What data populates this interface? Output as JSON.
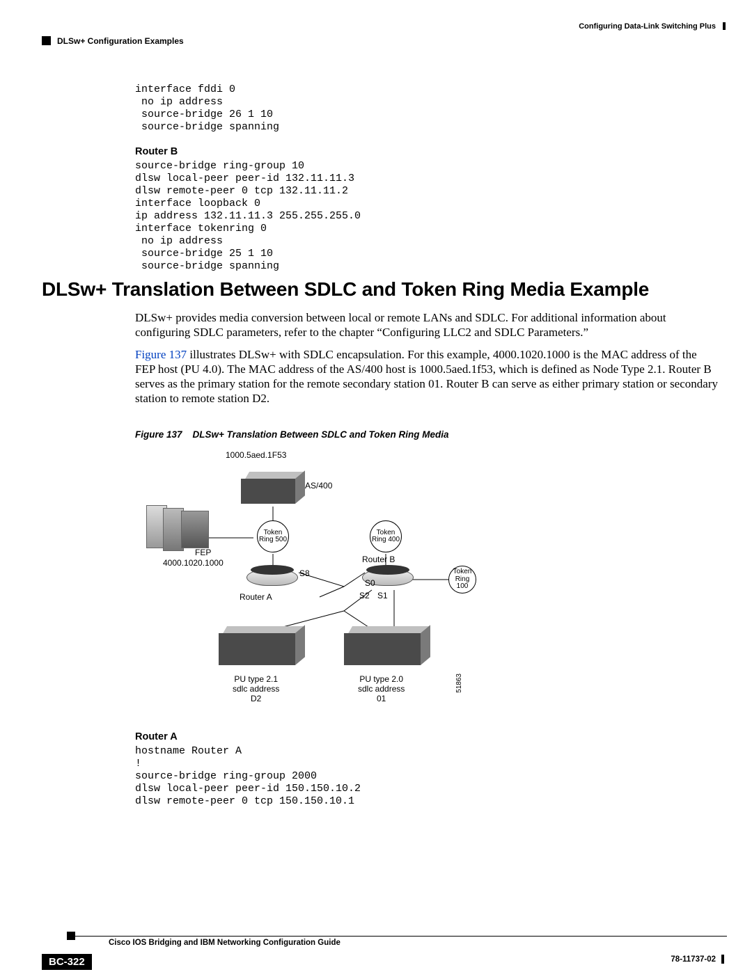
{
  "header": {
    "chapter": "Configuring Data-Link Switching Plus",
    "section": "DLSw+ Configuration Examples"
  },
  "code_block_1": "interface fddi 0\n no ip address\n source-bridge 26 1 10\n source-bridge spanning",
  "router_b_heading": "Router B",
  "code_block_2": "source-bridge ring-group 10\ndlsw local-peer peer-id 132.11.11.3\ndlsw remote-peer 0 tcp 132.11.11.2\ninterface loopback 0\nip address 132.11.11.3 255.255.255.0\ninterface tokenring 0\n no ip address\n source-bridge 25 1 10\n source-bridge spanning",
  "main_heading": "DLSw+ Translation Between SDLC and Token Ring Media Example",
  "para1": "DLSw+ provides media conversion between local or remote LANs and SDLC. For additional information about configuring SDLC parameters, refer to the chapter “Configuring LLC2 and SDLC Parameters.”",
  "para2_link": "Figure 137",
  "para2_rest": " illustrates DLSw+ with SDLC encapsulation. For this example, 4000.1020.1000 is the MAC address of the FEP host (PU 4.0). The MAC address of the AS/400 host is 1000.5aed.1f53, which is defined as Node Type 2.1. Router B serves as the primary station for the remote secondary station 01. Router B can serve as either primary station or secondary station to remote station D2.",
  "figure_caption_prefix": "Figure 137",
  "figure_caption_title": "DLSw+ Translation Between SDLC and Token Ring Media",
  "diagram": {
    "as400_mac": "1000.5aed.1F53",
    "as400_label": "AS/400",
    "fep_label": "FEP",
    "fep_mac": "4000.1020.1000",
    "tr500": "Token\nRing\n500",
    "tr400": "Token\nRing\n400",
    "tr100": "Token\nRing\n100",
    "router_a": "Router A",
    "router_b": "Router B",
    "s8": "S8",
    "s0": "S0",
    "s1": "S1",
    "s2": "S2",
    "pu21": "PU type 2.1\nsdlc address\nD2",
    "pu20": "PU type 2.0\nsdlc address\n01",
    "ref_id": "51863"
  },
  "router_a_heading": "Router A",
  "code_block_3": "hostname Router A\n!\nsource-bridge ring-group 2000\ndlsw local-peer peer-id 150.150.10.2\ndlsw remote-peer 0 tcp 150.150.10.1",
  "footer": {
    "guide": "Cisco IOS Bridging and IBM Networking Configuration Guide",
    "page": "BC-322",
    "docnum": "78-11737-02"
  }
}
